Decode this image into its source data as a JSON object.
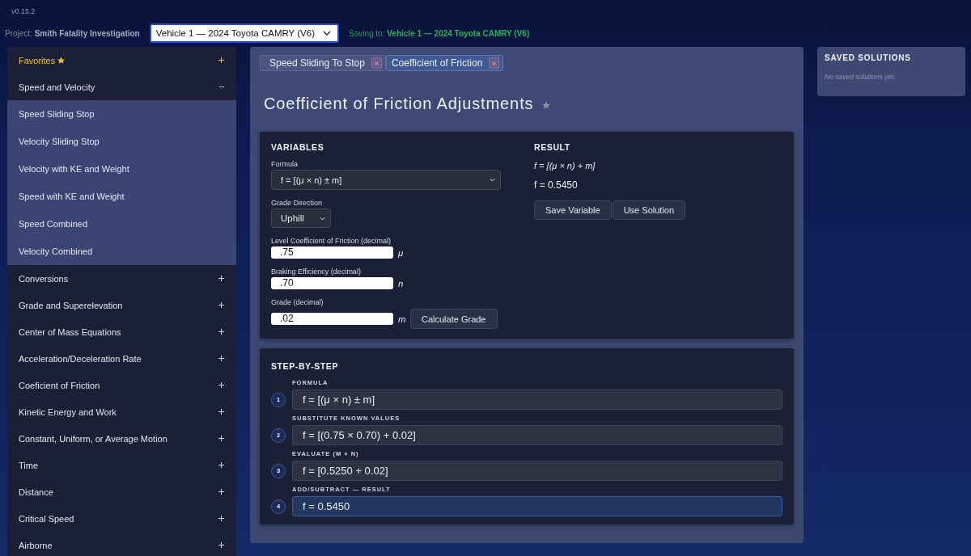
{
  "app": {
    "version": "v0.15.2"
  },
  "header": {
    "project": "Project: **Smith Fatality Investigation**",
    "vehicle_select": {
      "value": "Vehicle 1 — 2024 Toyota CAMRY (V6)"
    },
    "saving": "Saving to: **Vehicle 1 — 2024 Toyota CAMRY (V6)**"
  },
  "sidebar": {
    "sections": [
      {
        "label": "Favorites",
        "kind": "favorites",
        "expanded": false
      },
      {
        "label": "Speed and Velocity",
        "kind": "category",
        "expanded": true,
        "children": [
          {
            "label": "Speed Sliding Stop"
          },
          {
            "label": "Velocity Sliding Stop"
          },
          {
            "label": "Velocity with KE and Weight"
          },
          {
            "label": "Speed with KE and Weight"
          },
          {
            "label": "Speed Combined"
          },
          {
            "label": "Velocity Combined"
          }
        ]
      },
      {
        "label": "Conversions",
        "kind": "category",
        "expanded": false
      },
      {
        "label": "Grade and Superelevation",
        "kind": "category",
        "expanded": false
      },
      {
        "label": "Center of Mass Equations",
        "kind": "category",
        "expanded": false
      },
      {
        "label": "Acceleration/Deceleration Rate",
        "kind": "category",
        "expanded": false
      },
      {
        "label": "Coeficient of Friction",
        "kind": "category",
        "expanded": false
      },
      {
        "label": "Kinetic Energy and Work",
        "kind": "category",
        "expanded": false
      },
      {
        "label": "Constant, Uniform, or Average Motion",
        "kind": "category",
        "expanded": false
      },
      {
        "label": "Time",
        "kind": "category",
        "expanded": false
      },
      {
        "label": "Distance",
        "kind": "category",
        "expanded": false
      },
      {
        "label": "Critical Speed",
        "kind": "category",
        "expanded": false
      },
      {
        "label": "Airborne",
        "kind": "category",
        "expanded": false
      }
    ]
  },
  "tabs": [
    {
      "label": "Speed Sliding To Stop",
      "selected": false
    },
    {
      "label": "Coefficient of Friction",
      "selected": true
    }
  ],
  "page": {
    "title": "Coefficient of Friction Adjustments",
    "favorite": false
  },
  "variables": {
    "heading": "VARIABLES",
    "formula": {
      "label": "Formula",
      "value": "f = [(μ × n) ± m]"
    },
    "grade_direction": {
      "label": "Grade Direction",
      "value": "Uphill"
    },
    "inputs": [
      {
        "label": "Level Coefficient of Friction (decimal)",
        "value": ".75",
        "symbol": "μ"
      },
      {
        "label": "Braking Efficiency (decimal)",
        "value": ".70",
        "symbol": "n"
      },
      {
        "label": "Grade (decimal)",
        "value": ".02",
        "symbol": "m",
        "button": "Calculate Grade"
      }
    ]
  },
  "result": {
    "heading": "RESULT",
    "formula": "f = [(μ × n) + m]",
    "value": "f = 0.5450",
    "buttons": [
      "Save Variable",
      "Use Solution"
    ]
  },
  "steps": {
    "heading": "STEP-BY-STEP",
    "items": [
      {
        "number": "1",
        "label": "FORMULA",
        "expression": "f = [(μ × n) ± m]",
        "highlighted": false
      },
      {
        "number": "2",
        "label": "SUBSTITUTE KNOWN VALUES",
        "expression": "f = [(0.75 × 0.70) + 0.02]",
        "highlighted": false
      },
      {
        "number": "3",
        "label": "EVALUATE (M × N)",
        "expression": "f = [0.5250 + 0.02]",
        "highlighted": false
      },
      {
        "number": "4",
        "label": "ADD/SUBTRACT — RESULT",
        "expression": "f = 0.5450",
        "highlighted": true
      }
    ]
  },
  "saved_solutions": {
    "heading": "SAVED SOLUTIONS",
    "empty_text": "No saved solutions yet."
  }
}
